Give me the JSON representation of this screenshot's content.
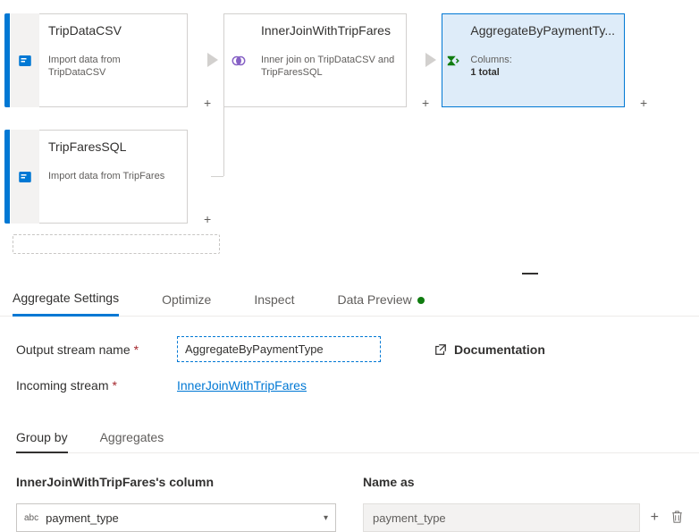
{
  "nodes": {
    "source1": {
      "title": "TripDataCSV",
      "desc": "Import data from TripDataCSV"
    },
    "source2": {
      "title": "TripFaresSQL",
      "desc": "Import data from TripFares"
    },
    "join": {
      "title": "InnerJoinWithTripFares",
      "desc": "Inner join on TripDataCSV and TripFaresSQL"
    },
    "agg": {
      "title": "AggregateByPaymentTy...",
      "columns_label": "Columns:",
      "columns_value": "1 total"
    }
  },
  "tabs": {
    "aggregate": "Aggregate Settings",
    "optimize": "Optimize",
    "inspect": "Inspect",
    "preview": "Data Preview"
  },
  "form": {
    "output_label": "Output stream name",
    "output_value": "AggregateByPaymentType",
    "incoming_label": "Incoming stream",
    "incoming_value": "InnerJoinWithTripFares",
    "documentation": "Documentation"
  },
  "subtabs": {
    "groupby": "Group by",
    "aggregates": "Aggregates"
  },
  "grid": {
    "col1_header": "InnerJoinWithTripFares's column",
    "col2_header": "Name as",
    "col1_value": "payment_type",
    "col2_value": "payment_type",
    "abc": "abc"
  },
  "glyphs": {
    "plus": "+",
    "caret": "▾"
  }
}
